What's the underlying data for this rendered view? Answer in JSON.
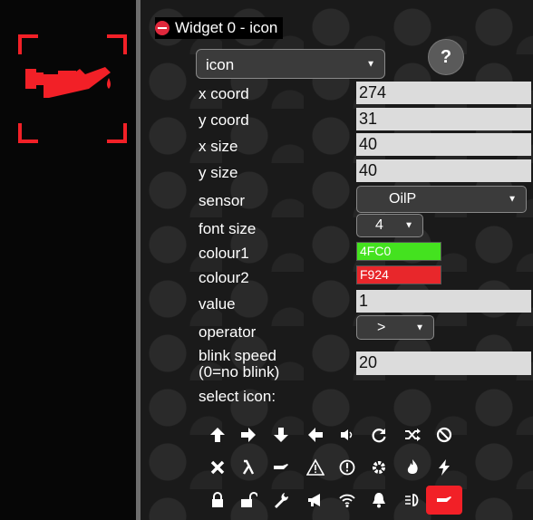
{
  "widget": {
    "title": "Widget 0 - icon",
    "type": "icon"
  },
  "fields": {
    "x_coord": {
      "label": "x coord",
      "value": "274"
    },
    "y_coord": {
      "label": "y coord",
      "value": "31"
    },
    "x_size": {
      "label": "x size",
      "value": "40"
    },
    "y_size": {
      "label": "y size",
      "value": "40"
    },
    "sensor": {
      "label": "sensor",
      "value": "OilP"
    },
    "font_size": {
      "label": "font size",
      "value": "4"
    },
    "colour1": {
      "label": "colour1",
      "value": "4FC0",
      "color": "#44e21f"
    },
    "colour2": {
      "label": "colour2",
      "value": "F924",
      "color": "#e8272b"
    },
    "value": {
      "label": "value",
      "value": "1"
    },
    "operator": {
      "label": "operator",
      "value": ">"
    },
    "blink_speed": {
      "label_line1": "blink speed",
      "label_line2": "(0=no blink)",
      "value": "20"
    }
  },
  "help": {
    "label": "?"
  },
  "select_icon_label": "select icon:",
  "icons": [
    "arrow-up-icon",
    "arrow-right-icon",
    "arrow-down-icon",
    "arrow-left-icon",
    "speaker-icon",
    "refresh-icon",
    "shuffle-icon",
    "ban-icon",
    "close-icon",
    "lambda-icon",
    "oil-can-icon",
    "warning-icon",
    "exclamation-icon",
    "gear-icon",
    "fire-icon",
    "lightning-icon",
    "lock-icon",
    "unlock-icon",
    "wrench-icon",
    "megaphone-icon",
    "wifi-icon",
    "bell-icon",
    "headlight-icon",
    "oil-can-selected-icon"
  ],
  "selected_icon": "oil-can-selected-icon",
  "preview_color": "#f22027"
}
